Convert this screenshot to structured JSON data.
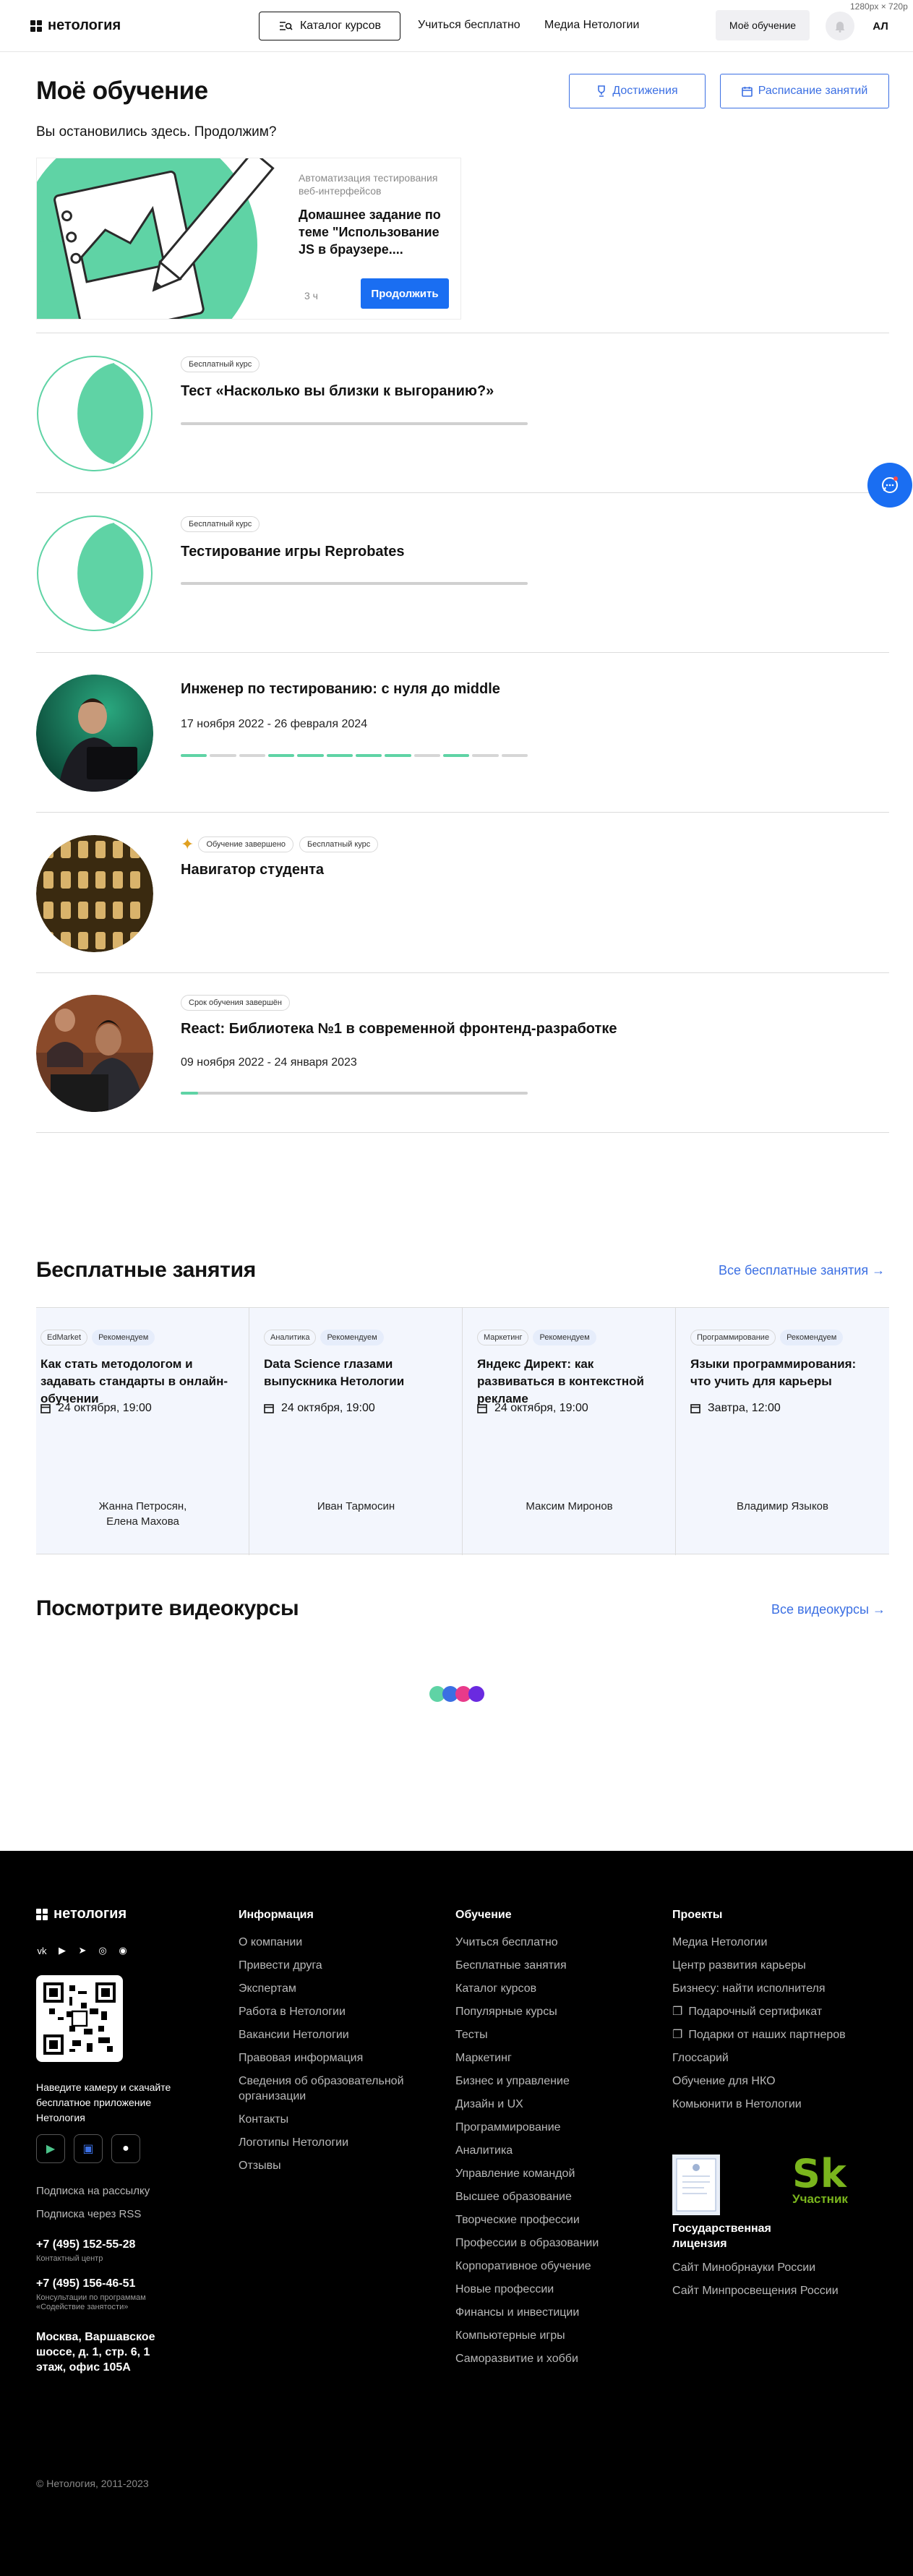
{
  "header": {
    "logo": "нетология",
    "catalog_label": "Каталог курсов",
    "nav": [
      "Учиться бесплатно",
      "Медиа Нетологии"
    ],
    "my_learning_label": "Моё обучение",
    "avatar_initials": "АЛ",
    "dims_note": "1280px × 720p"
  },
  "learning": {
    "title": "Моё обучение",
    "achievements_label": "Достижения",
    "schedule_label": "Расписание занятий",
    "resume_text": "Вы остановились здесь. Продолжим?",
    "continue_card": {
      "category": "Автоматизация тестирования веб-интерфейсов",
      "title": "Домашнее задание по теме \"Использование JS в браузере....",
      "time": "3 ч",
      "button": "Продолжить"
    },
    "courses": [
      {
        "badges": [
          "Бесплатный курс"
        ],
        "title": "Тест «Насколько вы близки к выгоранию?»",
        "date": "",
        "progress": 0
      },
      {
        "badges": [
          "Бесплатный курс"
        ],
        "title": "Тестирование игры Reprobates",
        "date": "",
        "progress": 0
      },
      {
        "badges": [],
        "title": "Инженер по тестированию: с нуля до middle",
        "date": "17 ноября 2022 - 26 февраля 2024",
        "progress_segments": [
          1,
          0,
          0,
          1,
          1,
          1,
          1,
          1,
          0,
          1,
          0,
          0
        ]
      },
      {
        "badges": [
          "Обучение завершено",
          "Бесплатный курс"
        ],
        "title": "Навигатор студента",
        "date": "",
        "progress": 0
      },
      {
        "badges": [
          "Срок обучения завершён"
        ],
        "title": "React: Библиотека №1 в современной фронтенд-разработке",
        "date": "09 ноября 2022 - 24 января 2023",
        "progress": 0.05
      }
    ]
  },
  "free": {
    "title": "Бесплатные занятия",
    "all_link": "Все бесплатные занятия →",
    "cards": [
      {
        "tag": "EdMarket",
        "rec": "Рекомендуем",
        "title": "Как стать методологом и задавать стандарты в онлайн-обучении",
        "date": "24 октября, 19:00",
        "author": "Жанна Петросян,\nЕлена Махова"
      },
      {
        "tag": "Аналитика",
        "rec": "Рекомендуем",
        "title": "Data Science глазами выпускника Нетологии",
        "date": "24 октября, 19:00",
        "author": "Иван Тармосин"
      },
      {
        "tag": "Маркетинг",
        "rec": "Рекомендуем",
        "title": "Яндекс Директ: как развиваться в контекстной рекламе",
        "date": "24 октября, 19:00",
        "author": "Максим Миронов"
      },
      {
        "tag": "Программирование",
        "rec": "Рекомендуем",
        "title": "Языки программирования: что учить для карьеры",
        "date": "Завтра, 12:00",
        "author": "Владимир Языков"
      }
    ]
  },
  "videos": {
    "title": "Посмотрите видеокурсы",
    "all_link": "Все видеокурсы →"
  },
  "footer": {
    "logo": "нетология",
    "qr_text": "Наведите камеру и скачайте бесплатное приложение Нетология",
    "subscribe": "Подписка на рассылку",
    "rss": "Подписка через RSS",
    "phone1": "+7 (495) 152-55-28",
    "phone1_sub": "Контактный центр",
    "phone2": "+7 (495) 156-46-51",
    "phone2_sub": "Консультации по программам «Содействие занятости»",
    "address": "Москва, Варшавское шоссе, д. 1, стр. 6, 1 этаж, офис 105А",
    "copyright": "© Нетология, 2011-2023",
    "info_title": "Информация",
    "info": [
      "О компании",
      "Привести друга",
      "Экспертам",
      "Работа в Нетологии",
      "Вакансии Нетологии",
      "Правовая информация",
      "Сведения об образовательной организации",
      "Контакты",
      "Логотипы Нетологии",
      "Отзывы"
    ],
    "edu_title": "Обучение",
    "edu": [
      "Учиться бесплатно",
      "Бесплатные занятия",
      "Каталог курсов",
      "Популярные курсы",
      "Тесты",
      "Маркетинг",
      "Бизнес и управление",
      "Дизайн и UX",
      "Программирование",
      "Аналитика",
      "Управление командой",
      "Высшее образование",
      "Творческие профессии",
      "Профессии в образовании",
      "Корпоративное обучение",
      "Новые профессии",
      "Финансы и инвестиции",
      "Компьютерные игры",
      "Саморазвитие и хобби"
    ],
    "proj_title": "Проекты",
    "proj": [
      "Медиа Нетологии",
      "Центр развития карьеры",
      "Бизнесу: найти исполнителя",
      "Подарочный сертификат",
      "Подарки от наших партнеров",
      "Глоссарий",
      "Обучение для НКО",
      "Комьюнити в Нетологии"
    ],
    "license": "Государственная лицензия",
    "sk_label": "Участник",
    "ministry1": "Сайт Минобрнауки России",
    "ministry2": "Сайт Минпросвещения России"
  }
}
